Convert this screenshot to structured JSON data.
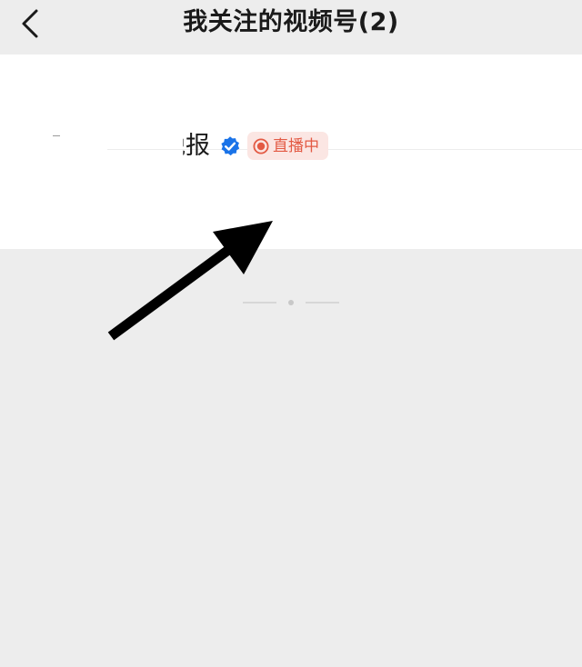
{
  "header": {
    "title": "我关注的视频号(2)",
    "back_icon": "chevron-left-icon"
  },
  "list": {
    "items": [
      {
        "name": "报"
      },
      {
        "name": "晚报",
        "verified": true,
        "status": "直播中"
      }
    ]
  },
  "colors": {
    "background": "#ededed",
    "panel": "#ffffff",
    "verified_blue": "#1a73e8",
    "live_red": "#e35a44",
    "live_bg": "#fbe6e3"
  }
}
